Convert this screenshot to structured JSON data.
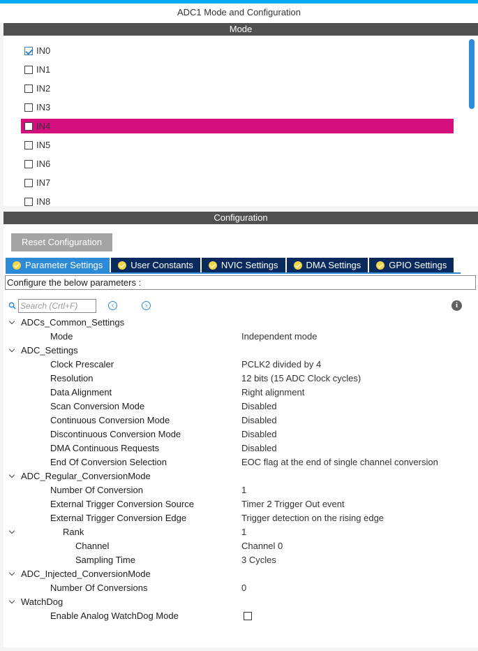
{
  "window": {
    "title": "ADC1 Mode and Configuration"
  },
  "mode_section": {
    "label": "Mode",
    "channels": [
      {
        "label": "IN0",
        "checked": true
      },
      {
        "label": "IN1",
        "checked": false
      },
      {
        "label": "IN2",
        "checked": false
      },
      {
        "label": "IN3",
        "checked": false
      },
      {
        "label": "IN4",
        "checked": false,
        "selected": true
      },
      {
        "label": "IN5",
        "checked": false
      },
      {
        "label": "IN6",
        "checked": false
      },
      {
        "label": "IN7",
        "checked": false
      },
      {
        "label": "IN8",
        "checked": false
      }
    ]
  },
  "config_section": {
    "label": "Configuration",
    "reset_button": "Reset Configuration",
    "tabs": [
      {
        "label": "Parameter Settings",
        "active": true
      },
      {
        "label": "User Constants"
      },
      {
        "label": "NVIC Settings"
      },
      {
        "label": "DMA Settings"
      },
      {
        "label": "GPIO Settings"
      }
    ],
    "description": "Configure the below parameters :",
    "search_placeholder": "Search (Crtl+F)",
    "params": [
      {
        "name": "ADCs_Common_Settings",
        "value": "",
        "group": true
      },
      {
        "name": "Mode",
        "value": "Independent mode"
      },
      {
        "name": "ADC_Settings",
        "value": "",
        "group": true
      },
      {
        "name": "Clock Prescaler",
        "value": "PCLK2 divided by 4"
      },
      {
        "name": "Resolution",
        "value": "12 bits (15 ADC Clock cycles)"
      },
      {
        "name": "Data Alignment",
        "value": "Right alignment"
      },
      {
        "name": "Scan Conversion Mode",
        "value": "Disabled"
      },
      {
        "name": "Continuous Conversion Mode",
        "value": "Disabled"
      },
      {
        "name": "Discontinuous Conversion Mode",
        "value": "Disabled"
      },
      {
        "name": "DMA Continuous Requests",
        "value": "Disabled"
      },
      {
        "name": "End Of Conversion Selection",
        "value": "EOC flag at the end of single channel conversion"
      },
      {
        "name": "ADC_Regular_ConversionMode",
        "value": "",
        "group": true
      },
      {
        "name": "Number Of Conversion",
        "value": "1"
      },
      {
        "name": "External Trigger Conversion Source",
        "value": "Timer 2 Trigger Out event"
      },
      {
        "name": "External Trigger Conversion Edge",
        "value": "Trigger detection on the rising edge"
      },
      {
        "name": "Rank",
        "value": "1",
        "group": true
      },
      {
        "name": "Channel",
        "value": "Channel 0"
      },
      {
        "name": "Sampling Time",
        "value": "3 Cycles"
      },
      {
        "name": "ADC_Injected_ConversionMode",
        "value": "",
        "group": true
      },
      {
        "name": "Number Of Conversions",
        "value": "0"
      },
      {
        "name": "WatchDog",
        "value": "",
        "group": true
      },
      {
        "name": "Enable Analog WatchDog Mode",
        "value": "",
        "checkbox": true,
        "checked": false
      }
    ]
  },
  "colors": {
    "selected_row": "#d40f7d",
    "active_tab": "#2c8ad6",
    "tab": "#0a2a5e",
    "section_bar": "#505050",
    "top_accent": "#03a9f4"
  }
}
